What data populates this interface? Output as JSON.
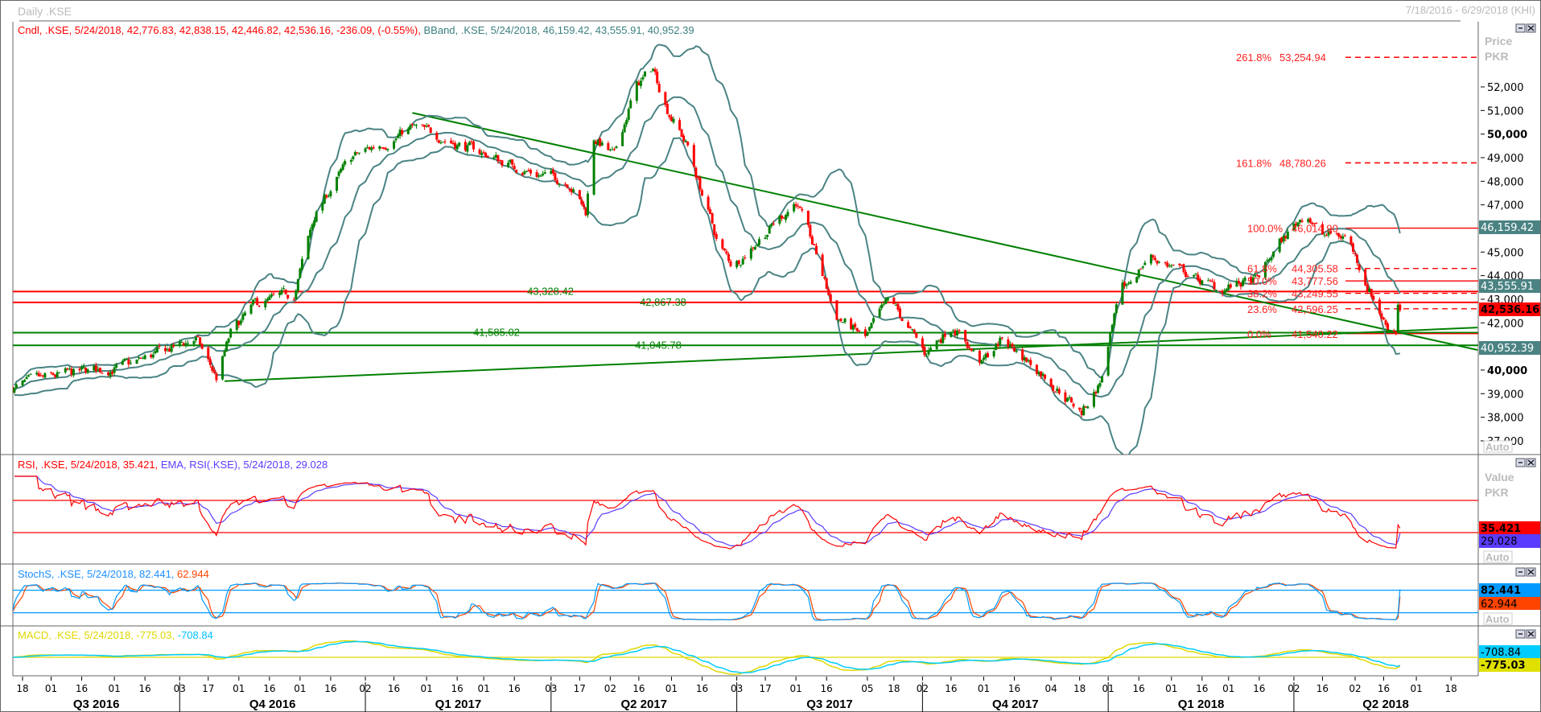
{
  "window": {
    "title": "Daily .KSE",
    "range": "7/18/2016 - 6/29/2018 (KHI)"
  },
  "legend": {
    "price_cndl": "Cndl, .KSE, 5/24/2018, 42,776.83, 42,838.15, 42,446.82, 42,536.16, -236.09, (-0.55%),",
    "price_bband": "BBand, .KSE, 5/24/2018, 46,159.42, 43,555.91, 40,952.39",
    "rsi": "RSI, .KSE, 5/24/2018, 35.421,",
    "rsi_ema": "EMA, RSI(.KSE), 5/24/2018, 29.028",
    "stoch_k": "StochS, .KSE, 5/24/2018, 82.441,",
    "stoch_d": "62.944",
    "macd": "MACD, .KSE, 5/24/2018, -775.03,",
    "macd_signal": "-708.84"
  },
  "axis_panel": {
    "price_title": "Price",
    "price_unit": "PKR",
    "value_title": "Value",
    "value_unit": "PKR",
    "auto_label": "Auto",
    "price_ticks": [
      "52,000",
      "51,000",
      "50,000",
      "49,000",
      "48,000",
      "47,000",
      "45,000",
      "44,000",
      "43,000",
      "42,000",
      "40,000",
      "39,000",
      "38,000",
      "37,000"
    ],
    "price_tick_values": [
      52000,
      51000,
      50000,
      49000,
      48000,
      47000,
      45000,
      44000,
      43000,
      42000,
      40000,
      39000,
      38000,
      37000
    ],
    "price_markers": {
      "bb_upper": "46,159.42",
      "bb_mid": "43,555.91",
      "last": "42,536.16",
      "bb_lower": "40,952.39"
    },
    "rsi_markers": {
      "rsi": "35.421",
      "ema": "29.028"
    },
    "stoch_markers": {
      "k": "82.441",
      "d": "62.944"
    },
    "macd_markers": {
      "signal": "-708.84",
      "macd": "-775.03"
    }
  },
  "colors": {
    "up": "#008000",
    "down": "#ff0000",
    "band": "#4b8383",
    "trend": "#008000",
    "rsi": "#ff0000",
    "rsi_ema": "#5a3cff",
    "stoch_k": "#0099ff",
    "stoch_d": "#ff4400",
    "macd": "#e0d800",
    "macd_signal": "#00ccff"
  },
  "chart_data": {
    "type": "candlestick",
    "symbol": ".KSE",
    "interval": "Daily",
    "ylim": [
      36500,
      53500
    ],
    "last_bar": {
      "date": "2018-05-24",
      "open": 42776.83,
      "high": 42838.15,
      "low": 42446.82,
      "close": 42536.16,
      "change": -236.09,
      "change_pct": -0.55
    },
    "close_path": [
      [
        "2016-07-13",
        39250
      ],
      [
        "2016-08-05",
        39760
      ],
      [
        "2016-09-08",
        40200
      ],
      [
        "2016-10-11",
        41330
      ],
      [
        "2016-10-21",
        39650
      ],
      [
        "2016-10-28",
        41530
      ],
      [
        "2016-11-09",
        42760
      ],
      [
        "2016-11-28",
        43200
      ],
      [
        "2016-12-08",
        46500
      ],
      [
        "2016-12-18",
        47980
      ],
      [
        "2016-12-27",
        49030
      ],
      [
        "2017-01-11",
        49650
      ],
      [
        "2017-01-25",
        50260
      ],
      [
        "2017-02-09",
        49850
      ],
      [
        "2017-03-05",
        49030
      ],
      [
        "2017-03-24",
        48390
      ],
      [
        "2017-04-12",
        47980
      ],
      [
        "2017-04-20",
        46700
      ],
      [
        "2017-04-24",
        49850
      ],
      [
        "2017-05-04",
        49030
      ],
      [
        "2017-05-14",
        51930
      ],
      [
        "2017-05-23",
        52780
      ],
      [
        "2017-05-30",
        51100
      ],
      [
        "2017-06-09",
        49440
      ],
      [
        "2017-06-24",
        45280
      ],
      [
        "2017-07-01",
        44430
      ],
      [
        "2017-07-13",
        45490
      ],
      [
        "2017-08-01",
        47160
      ],
      [
        "2017-08-11",
        44840
      ],
      [
        "2017-08-20",
        42350
      ],
      [
        "2017-09-04",
        41330
      ],
      [
        "2017-09-16",
        43000
      ],
      [
        "2017-10-03",
        40680
      ],
      [
        "2017-10-17",
        41940
      ],
      [
        "2017-10-31",
        40270
      ],
      [
        "2017-11-10",
        41330
      ],
      [
        "2017-11-30",
        39860
      ],
      [
        "2017-12-19",
        38190
      ],
      [
        "2017-12-28",
        39450
      ],
      [
        "2018-01-07",
        43200
      ],
      [
        "2018-01-21",
        44840
      ],
      [
        "2018-02-05",
        44230
      ],
      [
        "2018-02-24",
        43400
      ],
      [
        "2018-03-15",
        43810
      ],
      [
        "2018-03-25",
        45280
      ],
      [
        "2018-04-08",
        46710
      ],
      [
        "2018-04-16",
        45690
      ],
      [
        "2018-04-28",
        45690
      ],
      [
        "2018-05-07",
        43810
      ],
      [
        "2018-05-17",
        41940
      ],
      [
        "2018-05-22",
        41700
      ],
      [
        "2018-05-23",
        42772
      ],
      [
        "2018-05-24",
        42536.16
      ]
    ],
    "bollinger": {
      "period": 20,
      "stddev": 2,
      "upper": 46159.42,
      "middle": 43555.91,
      "lower": 40952.39
    },
    "horizontal_lines": [
      {
        "value": 43328.42,
        "label": "43,328.42",
        "color": "red"
      },
      {
        "value": 42867.38,
        "label": "42,867.38",
        "color": "red"
      },
      {
        "value": 41585.02,
        "label": "41,585.02",
        "color": "green"
      },
      {
        "value": 41045.78,
        "label": "41,045.78",
        "color": "green"
      }
    ],
    "trendlines": [
      {
        "from": [
          "2017-01-25",
          50900
        ],
        "to": [
          "2018-07-01",
          40850
        ]
      },
      {
        "from": [
          "2016-10-25",
          39530
        ],
        "to": [
          "2018-07-01",
          41800
        ]
      }
    ],
    "fibonacci": [
      {
        "pct": "261.8%",
        "value": "53,254.94",
        "v": 53254.94,
        "dashed": true
      },
      {
        "pct": "161.8%",
        "value": "48,780.26",
        "v": 48780.26,
        "dashed": true
      },
      {
        "pct": "100.0%",
        "value": "46,014.90",
        "v": 46014.9,
        "dashed": false
      },
      {
        "pct": "61.8%",
        "value": "44,305.58",
        "v": 44305.58,
        "dashed": true
      },
      {
        "pct": "50.0%",
        "value": "43,777.56",
        "v": 43777.56,
        "dashed": false
      },
      {
        "pct": "38.2%",
        "value": "43,249.55",
        "v": 43249.55,
        "dashed": true
      },
      {
        "pct": "23.6%",
        "value": "42,596.25",
        "v": 42596.25,
        "dashed": true
      },
      {
        "pct": "0.0%",
        "value": "41,540.22",
        "v": 41540.22,
        "dashed": false
      }
    ],
    "rsi": {
      "period": 14,
      "ema_period": 9,
      "last": 35.421,
      "ema_last": 29.028,
      "levels": [
        70,
        30
      ]
    },
    "stoch": {
      "k_last": 82.441,
      "d_last": 62.944,
      "levels": [
        80,
        20
      ]
    },
    "macd": {
      "macd_last": -775.03,
      "signal_last": -708.84
    },
    "x_ticks": [
      [
        "18",
        "2016-07-18"
      ],
      [
        "01",
        "2016-08-01"
      ],
      [
        "16",
        "2016-08-16"
      ],
      [
        "01",
        "2016-09-01"
      ],
      [
        "16",
        "2016-09-16"
      ],
      [
        "03",
        "2016-10-03"
      ],
      [
        "17",
        "2016-10-17"
      ],
      [
        "01",
        "2016-11-01"
      ],
      [
        "16",
        "2016-11-16"
      ],
      [
        "01",
        "2016-12-01"
      ],
      [
        "16",
        "2016-12-16"
      ],
      [
        "02",
        "2017-01-02"
      ],
      [
        "16",
        "2017-01-16"
      ],
      [
        "01",
        "2017-02-01"
      ],
      [
        "16",
        "2017-02-16"
      ],
      [
        "01",
        "2017-03-01"
      ],
      [
        "16",
        "2017-03-16"
      ],
      [
        "03",
        "2017-04-03"
      ],
      [
        "17",
        "2017-04-17"
      ],
      [
        "02",
        "2017-05-02"
      ],
      [
        "16",
        "2017-05-16"
      ],
      [
        "01",
        "2017-06-01"
      ],
      [
        "16",
        "2017-06-16"
      ],
      [
        "03",
        "2017-07-03"
      ],
      [
        "17",
        "2017-07-17"
      ],
      [
        "01",
        "2017-08-01"
      ],
      [
        "16",
        "2017-08-16"
      ],
      [
        "05",
        "2017-09-05"
      ],
      [
        "18",
        "2017-09-18"
      ],
      [
        "02",
        "2017-10-02"
      ],
      [
        "16",
        "2017-10-16"
      ],
      [
        "01",
        "2017-11-01"
      ],
      [
        "16",
        "2017-11-16"
      ],
      [
        "04",
        "2017-12-04"
      ],
      [
        "18",
        "2017-12-18"
      ],
      [
        "01",
        "2018-01-01"
      ],
      [
        "16",
        "2018-01-16"
      ],
      [
        "01",
        "2018-02-01"
      ],
      [
        "16",
        "2018-02-16"
      ],
      [
        "01",
        "2018-03-01"
      ],
      [
        "16",
        "2018-03-16"
      ],
      [
        "02",
        "2018-04-02"
      ],
      [
        "16",
        "2018-04-16"
      ],
      [
        "02",
        "2018-05-02"
      ],
      [
        "16",
        "2018-05-16"
      ],
      [
        "01",
        "2018-06-01"
      ],
      [
        "18",
        "2018-06-18"
      ]
    ],
    "quarters": [
      {
        "label": "Q3 2016",
        "start": "2016-07-12",
        "end": "2016-10-03"
      },
      {
        "label": "Q4 2016",
        "start": "2016-10-03",
        "end": "2017-01-02"
      },
      {
        "label": "Q1 2017",
        "start": "2017-01-02",
        "end": "2017-04-03"
      },
      {
        "label": "Q2 2017",
        "start": "2017-04-03",
        "end": "2017-07-03"
      },
      {
        "label": "Q3 2017",
        "start": "2017-07-03",
        "end": "2017-10-02"
      },
      {
        "label": "Q4 2017",
        "start": "2017-10-02",
        "end": "2018-01-01"
      },
      {
        "label": "Q1 2018",
        "start": "2018-01-01",
        "end": "2018-04-02"
      },
      {
        "label": "Q2 2018",
        "start": "2018-04-02",
        "end": "2018-07-01"
      }
    ]
  }
}
